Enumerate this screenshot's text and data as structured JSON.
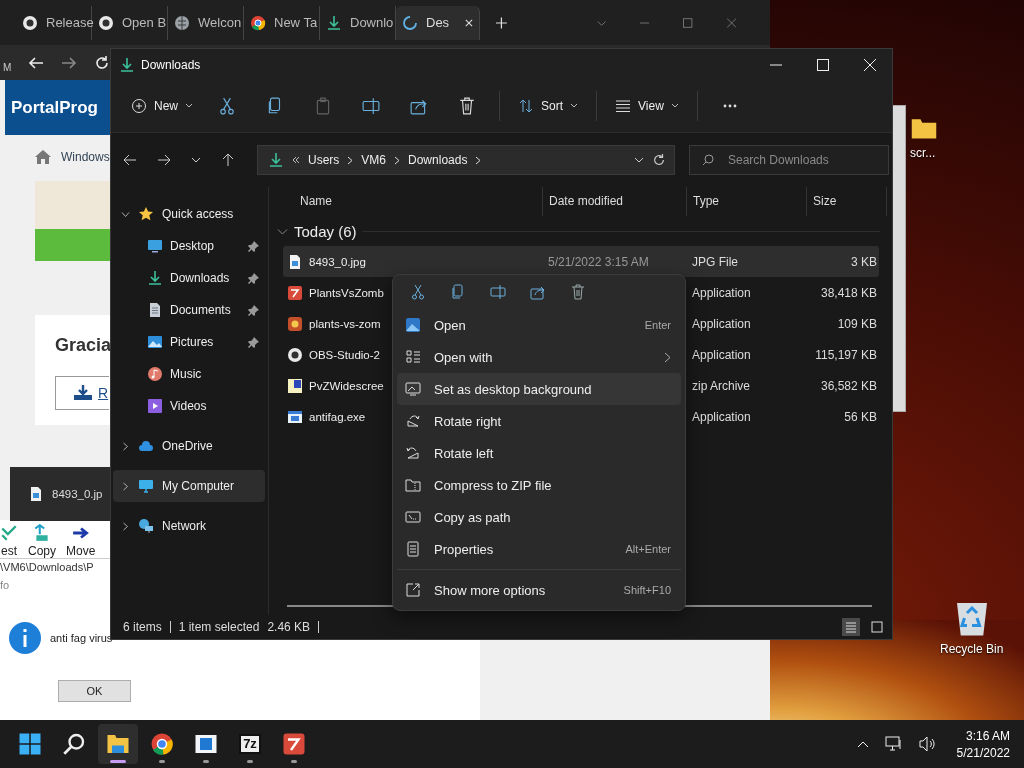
{
  "browser": {
    "tabs": [
      {
        "label": "Release",
        "selected": false
      },
      {
        "label": "Open B",
        "selected": false
      },
      {
        "label": "Welcon",
        "selected": false
      },
      {
        "label": "New Ta",
        "selected": false
      },
      {
        "label": "Downlo",
        "selected": false
      },
      {
        "label": "Des",
        "selected": true
      }
    ],
    "nav_fragment": "M",
    "page": {
      "logo": "PortalProg",
      "breadcrumb": "Windows",
      "heading": "Gracia",
      "download_button": "R"
    }
  },
  "drag_preview": {
    "label": "8493_0.jp"
  },
  "archiver": {
    "toolbar": [
      "est",
      "Copy",
      "Move"
    ],
    "path": "\\VM6\\Downloads\\P",
    "tab": "fo"
  },
  "message_box": {
    "text": "anti fag virus",
    "button": "OK"
  },
  "explorer": {
    "title": "Downloads",
    "toolbar": [
      {
        "kind": "menu",
        "label": "New",
        "disabled": false
      },
      {
        "kind": "icon",
        "disabled": false
      },
      {
        "kind": "icon",
        "disabled": false
      },
      {
        "kind": "icon",
        "disabled": true
      },
      {
        "kind": "icon",
        "disabled": false
      },
      {
        "kind": "icon",
        "disabled": false
      },
      {
        "kind": "icon",
        "disabled": false
      },
      {
        "kind": "menu",
        "label": "Sort",
        "disabled": false
      },
      {
        "kind": "menu",
        "label": "View",
        "disabled": false
      },
      {
        "kind": "icon",
        "disabled": false
      }
    ],
    "path": [
      "Users",
      "VM6",
      "Downloads"
    ],
    "search": {
      "placeholder": "Search Downloads"
    },
    "nav": [
      {
        "label": "Quick access",
        "expanded": true,
        "selected": false,
        "children": [
          {
            "label": "Desktop",
            "pinned": true,
            "selected": false
          },
          {
            "label": "Downloads",
            "pinned": true,
            "selected": false
          },
          {
            "label": "Documents",
            "pinned": true,
            "selected": false
          },
          {
            "label": "Pictures",
            "pinned": true,
            "selected": false
          },
          {
            "label": "Music",
            "pinned": false,
            "selected": false
          },
          {
            "label": "Videos",
            "pinned": false,
            "selected": false
          }
        ]
      },
      {
        "label": "OneDrive",
        "expanded": false,
        "selected": false
      },
      {
        "label": "My Computer",
        "expanded": false,
        "selected": true
      },
      {
        "label": "Network",
        "expanded": false,
        "selected": false
      }
    ],
    "columns": [
      "Name",
      "Date modified",
      "Type",
      "Size"
    ],
    "group": {
      "label": "Today (6)",
      "expanded": true
    },
    "files": [
      {
        "name": "8493_0.jpg",
        "date": "5/21/2022 3:15 AM",
        "type": "JPG File",
        "size": "3 KB",
        "selected": true
      },
      {
        "name": "PlantsVsZomb",
        "type": "Application",
        "size": "38,418 KB",
        "selected": false
      },
      {
        "name": "plants-vs-zom",
        "type": "Application",
        "size": "109 KB",
        "selected": false
      },
      {
        "name": "OBS-Studio-2",
        "type": "Application",
        "size": "115,197 KB",
        "selected": false
      },
      {
        "name": "PvZWidescree",
        "type": "zip Archive",
        "size": "36,582 KB",
        "selected": false
      },
      {
        "name": "antifag.exe",
        "type": "Application",
        "size": "56 KB",
        "selected": false
      }
    ],
    "status": {
      "count": "6 items",
      "selection": "1 item selected",
      "selection_size": "2.46 KB"
    },
    "view_modes": [
      {
        "selected": true
      },
      {
        "selected": false
      }
    ]
  },
  "context_menu": {
    "items": [
      {
        "label": "Open",
        "shortcut": "Enter",
        "submenu": false,
        "selected": false
      },
      {
        "label": "Open with",
        "submenu": true,
        "selected": false
      },
      {
        "label": "Set as desktop background",
        "submenu": false,
        "selected": true
      },
      {
        "label": "Rotate right",
        "submenu": false,
        "selected": false
      },
      {
        "label": "Rotate left",
        "submenu": false,
        "selected": false
      },
      {
        "label": "Compress to ZIP file",
        "submenu": false,
        "selected": false
      },
      {
        "label": "Copy as path",
        "submenu": false,
        "selected": false
      },
      {
        "label": "Properties",
        "shortcut": "Alt+Enter",
        "submenu": false,
        "selected": false
      }
    ],
    "footer": {
      "label": "Show more options",
      "shortcut": "Shift+F10"
    }
  },
  "desktop": {
    "icons": [
      {
        "label": "scr..."
      },
      {
        "label": "Recycle Bin"
      }
    ]
  },
  "taskbar": {
    "apps": [
      {
        "running": false,
        "active": false
      },
      {
        "running": false,
        "active": false
      },
      {
        "running": true,
        "active": true
      },
      {
        "running": true,
        "active": false
      },
      {
        "running": true,
        "active": false
      },
      {
        "badge": "7z",
        "running": true,
        "active": false
      },
      {
        "running": true,
        "active": false
      }
    ],
    "time": "3:16 AM",
    "date": "5/21/2022"
  }
}
